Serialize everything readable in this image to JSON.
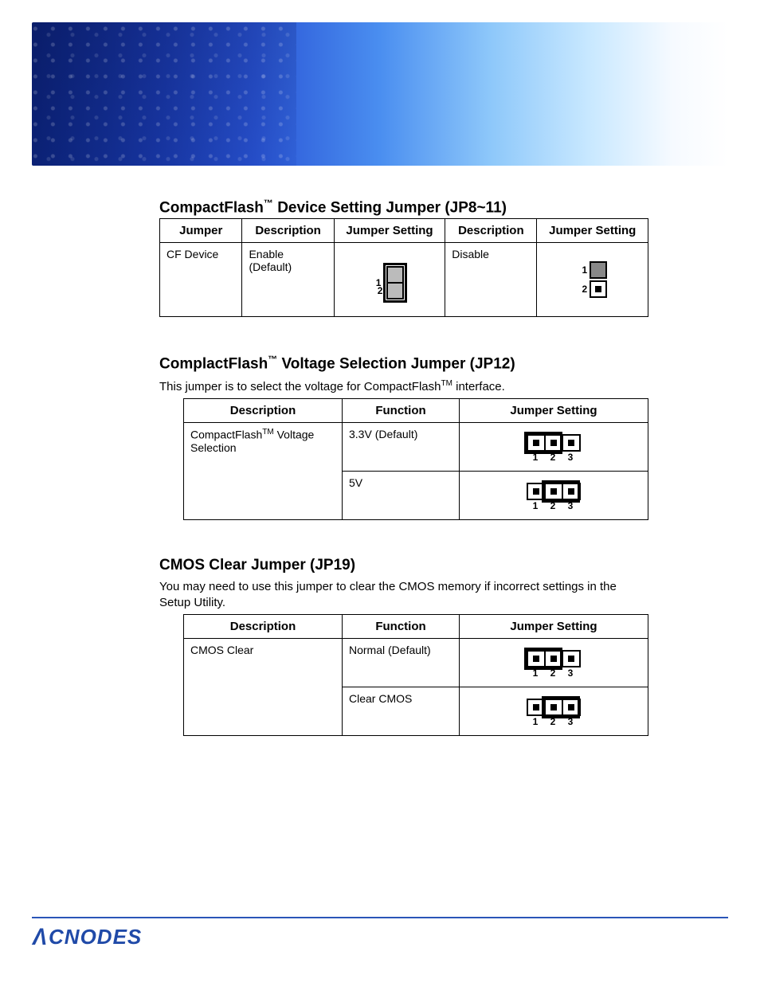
{
  "section1": {
    "title_a": "CompactFlash",
    "title_tm": "™",
    "title_b": " Device Setting Jumper (JP8~11)",
    "headers": [
      "Jumper",
      "Description",
      "Jumper Setting",
      "Description",
      "Jumper Setting"
    ],
    "row": {
      "jumper": "CF Device",
      "desc1": "Enable (Default)",
      "desc2": "Disable"
    }
  },
  "section2": {
    "title_a": "ComplactFlash",
    "title_tm": "™",
    "title_b": " Voltage Selection Jumper (JP12)",
    "intro_a": "This jumper is to select the voltage for CompactFlash",
    "intro_tm": "TM",
    "intro_b": "  interface.",
    "headers": [
      "Description",
      "Function",
      "Jumper Setting"
    ],
    "rows": [
      {
        "desc_a": "CompactFlash",
        "desc_tm": "TM",
        "desc_b": " Voltage Selection",
        "func": "3.3V (Default)",
        "short": "12"
      },
      {
        "desc": "",
        "func": "5V",
        "short": "23"
      }
    ]
  },
  "section3": {
    "title": "CMOS Clear Jumper (JP19)",
    "intro": "You may need to use this jumper to clear the CMOS memory if incorrect settings in the Setup Utility.",
    "headers": [
      "Description",
      "Function",
      "Jumper Setting"
    ],
    "rows": [
      {
        "desc": "CMOS Clear",
        "func": "Normal (Default)",
        "short": "12"
      },
      {
        "desc": "",
        "func": "Clear CMOS",
        "short": "23"
      }
    ]
  },
  "logo": "CNODES",
  "pin_labels": {
    "p1": "1",
    "p2": "2",
    "p3": "3"
  }
}
